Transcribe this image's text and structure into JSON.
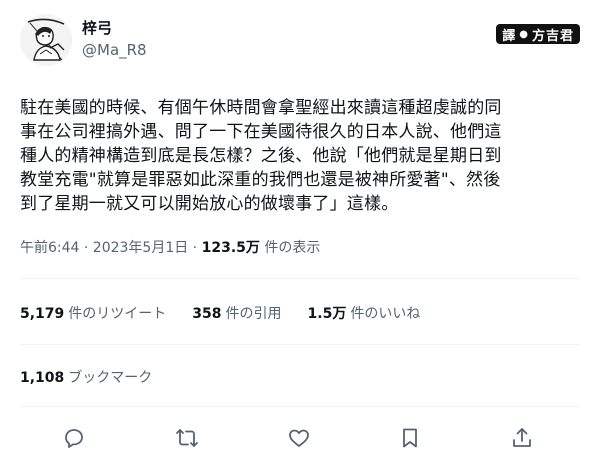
{
  "author": {
    "display_name": "梓弓",
    "handle": "@Ma_R8"
  },
  "watermark": {
    "left": "譯",
    "right": "方吉君"
  },
  "tweet": {
    "text": "駐在美國的時候、有個午休時間會拿聖經出來讀這種超虔誠的同\n事在公司裡搞外遇、問了一下在美國待很久的日本人說、他們這\n種人的精神構造到底是長怎樣？之後、他說「他們就是星期日到\n教堂充電\"就算是罪惡如此深重的我們也還是被神所愛著\"、然後\n到了星期一就又可以開始放心的做壞事了」這樣。"
  },
  "meta": {
    "timestamp": "午前6:44 · 2023年5月1日 · ",
    "views_count": "123.5万",
    "views_label": " 件の表示"
  },
  "stats": {
    "retweets_count": "5,179",
    "retweets_label": "件のリツイート",
    "quotes_count": "358",
    "quotes_label": "件の引用",
    "likes_count": "1.5万",
    "likes_label": "件のいいね",
    "bookmarks_count": "1,108",
    "bookmarks_label": "ブックマーク"
  },
  "actions": [
    "reply-icon",
    "retweet-icon",
    "like-icon",
    "bookmark-icon",
    "share-icon"
  ]
}
